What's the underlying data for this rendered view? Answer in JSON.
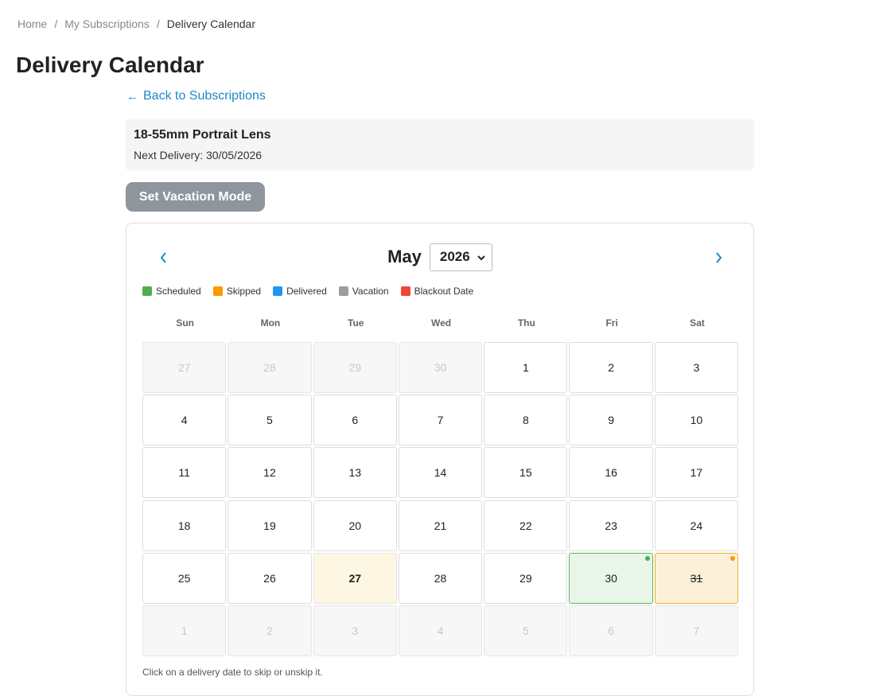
{
  "breadcrumb": {
    "home": "Home",
    "subscriptions": "My Subscriptions",
    "current": "Delivery Calendar",
    "separator": "/"
  },
  "page_title": "Delivery Calendar",
  "back_link": {
    "arrow": "←",
    "label": "Back to Subscriptions"
  },
  "product": {
    "name": "18-55mm Portrait Lens",
    "next_delivery_label": "Next Delivery: 30/05/2026"
  },
  "vacation_button": "Set Vacation Mode",
  "calendar": {
    "month": "May",
    "year": "2026",
    "prev_icon": "chevron-left-icon",
    "next_icon": "chevron-right-icon",
    "legend": [
      {
        "label": "Scheduled",
        "color": "#4caf50"
      },
      {
        "label": "Skipped",
        "color": "#ff9800"
      },
      {
        "label": "Delivered",
        "color": "#2196f3"
      },
      {
        "label": "Vacation",
        "color": "#9e9e9e"
      },
      {
        "label": "Blackout Date",
        "color": "#f44336"
      }
    ],
    "weekdays": [
      "Sun",
      "Mon",
      "Tue",
      "Wed",
      "Thu",
      "Fri",
      "Sat"
    ],
    "days": [
      {
        "label": "27",
        "state": "outside"
      },
      {
        "label": "28",
        "state": "outside"
      },
      {
        "label": "29",
        "state": "outside"
      },
      {
        "label": "30",
        "state": "outside"
      },
      {
        "label": "1",
        "state": "normal"
      },
      {
        "label": "2",
        "state": "normal"
      },
      {
        "label": "3",
        "state": "normal"
      },
      {
        "label": "4",
        "state": "normal"
      },
      {
        "label": "5",
        "state": "normal"
      },
      {
        "label": "6",
        "state": "normal"
      },
      {
        "label": "7",
        "state": "normal"
      },
      {
        "label": "8",
        "state": "normal"
      },
      {
        "label": "9",
        "state": "normal"
      },
      {
        "label": "10",
        "state": "normal"
      },
      {
        "label": "11",
        "state": "normal"
      },
      {
        "label": "12",
        "state": "normal"
      },
      {
        "label": "13",
        "state": "normal"
      },
      {
        "label": "14",
        "state": "normal"
      },
      {
        "label": "15",
        "state": "normal"
      },
      {
        "label": "16",
        "state": "normal"
      },
      {
        "label": "17",
        "state": "normal"
      },
      {
        "label": "18",
        "state": "normal"
      },
      {
        "label": "19",
        "state": "normal"
      },
      {
        "label": "20",
        "state": "normal"
      },
      {
        "label": "21",
        "state": "normal"
      },
      {
        "label": "22",
        "state": "normal"
      },
      {
        "label": "23",
        "state": "normal"
      },
      {
        "label": "24",
        "state": "normal"
      },
      {
        "label": "25",
        "state": "normal"
      },
      {
        "label": "26",
        "state": "normal"
      },
      {
        "label": "27",
        "state": "today"
      },
      {
        "label": "28",
        "state": "normal"
      },
      {
        "label": "29",
        "state": "normal"
      },
      {
        "label": "30",
        "state": "scheduled",
        "dot_color": "#4caf50"
      },
      {
        "label": "31",
        "state": "skipped",
        "dot_color": "#ff9800"
      },
      {
        "label": "1",
        "state": "outside"
      },
      {
        "label": "2",
        "state": "outside"
      },
      {
        "label": "3",
        "state": "outside"
      },
      {
        "label": "4",
        "state": "outside"
      },
      {
        "label": "5",
        "state": "outside"
      },
      {
        "label": "6",
        "state": "outside"
      },
      {
        "label": "7",
        "state": "outside"
      }
    ],
    "hint": "Click on a delivery date to skip or unskip it."
  }
}
